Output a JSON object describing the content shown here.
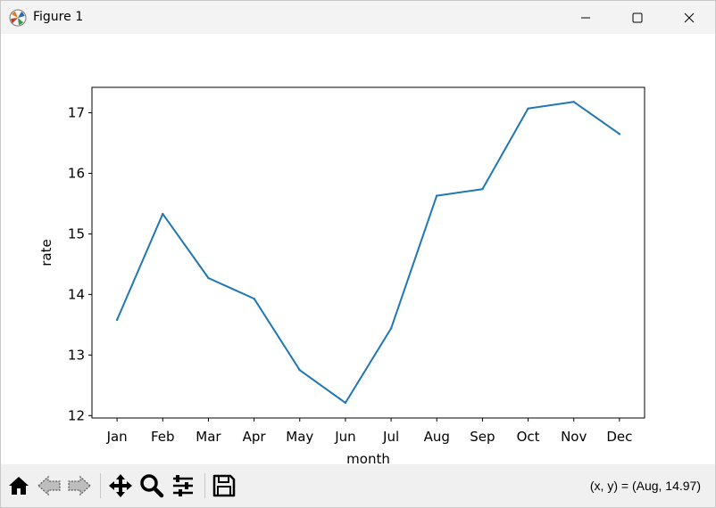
{
  "window": {
    "title": "Figure 1",
    "minimize_label": "—",
    "maximize_label": "☐",
    "close_label": "✕"
  },
  "toolbar": {
    "buttons": [
      {
        "name": "home-icon"
      },
      {
        "name": "back-icon"
      },
      {
        "name": "forward-icon"
      },
      {
        "name": "pan-icon"
      },
      {
        "name": "zoom-icon"
      },
      {
        "name": "configure-subplots-icon"
      },
      {
        "name": "save-icon"
      }
    ],
    "coords_text": "(x, y) = (Aug, 14.97)"
  },
  "chart_data": {
    "type": "line",
    "categories": [
      "Jan",
      "Feb",
      "Mar",
      "Apr",
      "May",
      "Jun",
      "Jul",
      "Aug",
      "Sep",
      "Oct",
      "Nov",
      "Dec"
    ],
    "series": [
      {
        "values": [
          13.58,
          15.33,
          14.27,
          13.93,
          12.75,
          12.21,
          13.44,
          15.63,
          15.74,
          17.07,
          17.18,
          16.65
        ],
        "color": "#1f77b4"
      }
    ],
    "xlabel": "month",
    "ylabel": "rate",
    "ylim": [
      11.96,
      17.42
    ],
    "yticks": [
      12,
      13,
      14,
      15,
      16,
      17
    ],
    "grid": false,
    "legend": false
  }
}
